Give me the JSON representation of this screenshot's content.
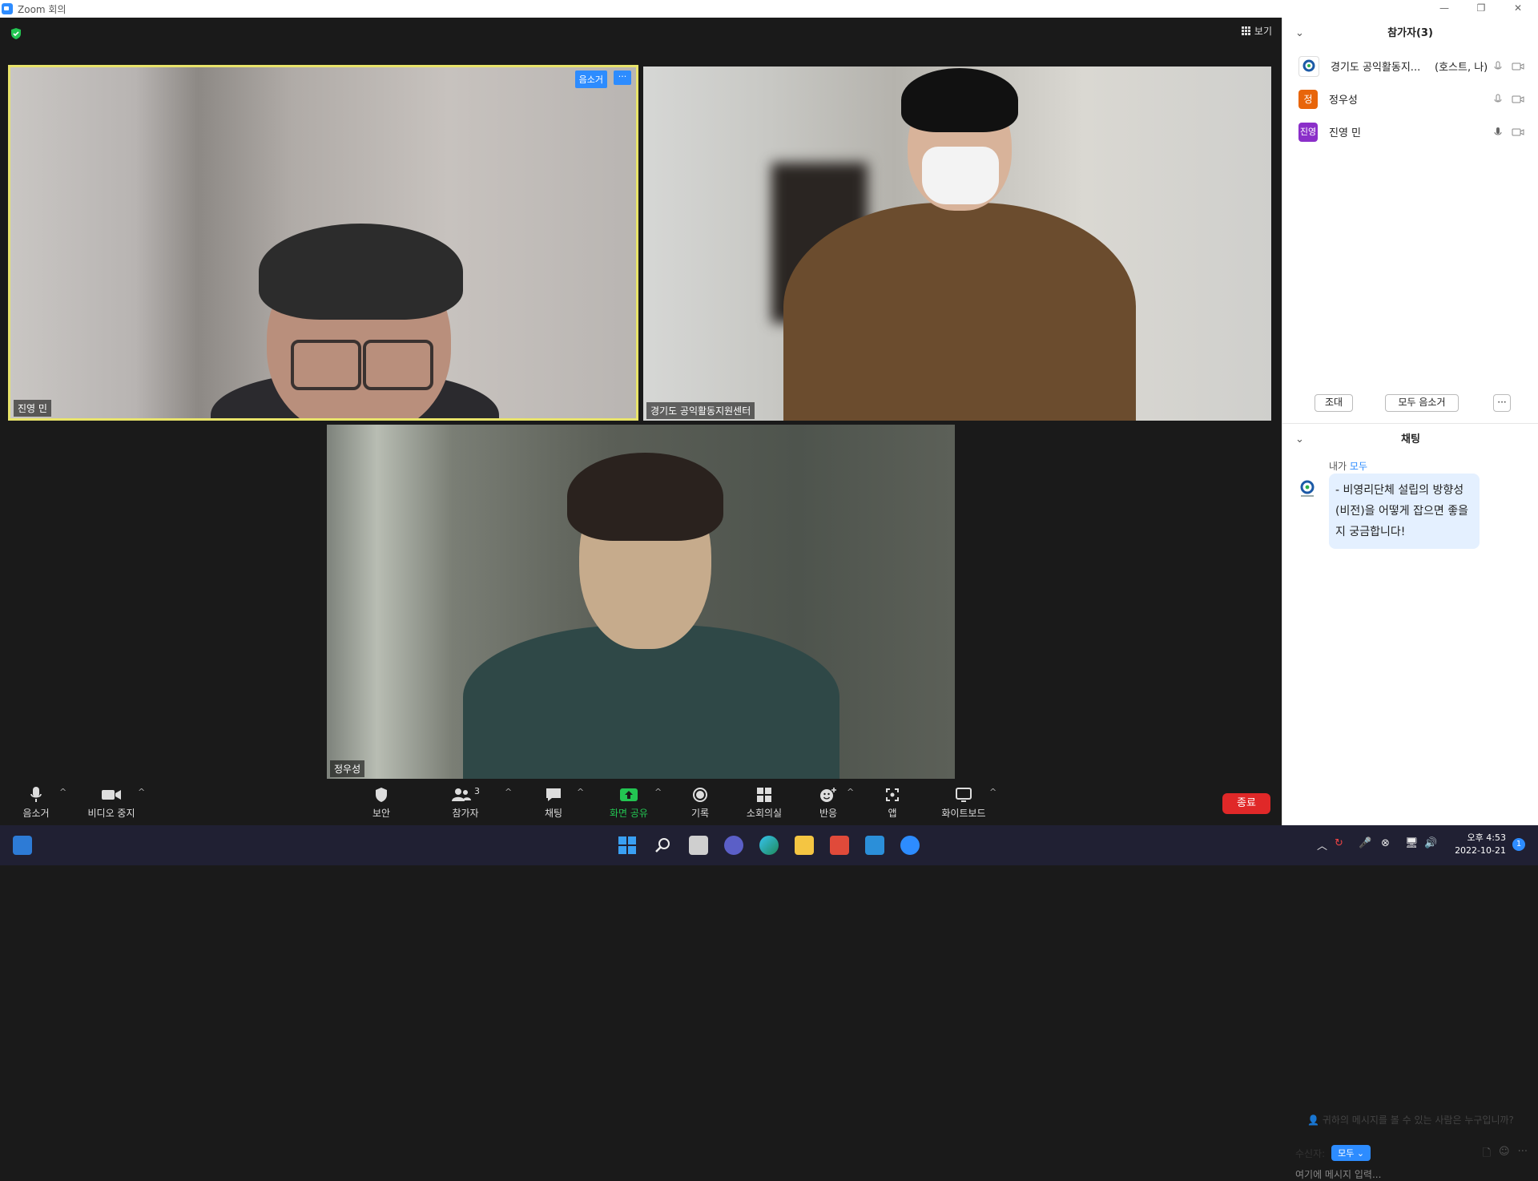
{
  "window": {
    "title": "Zoom 회의",
    "minimize": "—",
    "restore": "❐",
    "close": "✕"
  },
  "top": {
    "view_label": "보기"
  },
  "tiles": [
    {
      "name": "진영 민",
      "badge": "음소거",
      "more": "···"
    },
    {
      "name": "경기도 공익활동지원센터"
    },
    {
      "name": "정우성"
    }
  ],
  "toolbar": {
    "mute": "음소거",
    "video": "비디오 중지",
    "security": "보안",
    "participants": "참가자",
    "participants_count": "3",
    "chat": "채팅",
    "share": "화면 공유",
    "record": "기록",
    "breakout": "소회의실",
    "reactions": "반응",
    "apps": "앱",
    "whiteboard": "화이트보드",
    "end": "종료"
  },
  "participants_panel": {
    "title": "참가자(3)",
    "list": [
      {
        "name": "경기도 공익활동지...",
        "role": "(호스트, 나)",
        "avatar": "",
        "color": "#ffffff"
      },
      {
        "name": "정우성",
        "role": "",
        "avatar": "정",
        "color": "#e8650a"
      },
      {
        "name": "진영 민",
        "role": "",
        "avatar": "진영",
        "color": "#8b2fc9"
      }
    ],
    "invite": "조대",
    "mute_all": "모두 음소거",
    "more": "···"
  },
  "chat_panel": {
    "title": "채팅",
    "from": "내가",
    "to": "모두",
    "message": "- 비영리단체 설립의 방향성(비전)을 어떻게 잡으면 좋을지 궁금합니다!",
    "who_can_see": "귀하의 메시지를 볼 수 있는 사람은 누구입니까?",
    "recipient_label": "수신자:",
    "recipient_value": "모두",
    "input_placeholder": "여기에 메시지 입력..."
  },
  "taskbar": {
    "time": "오후 4:53",
    "date": "2022-10-21",
    "notifications": "1"
  }
}
